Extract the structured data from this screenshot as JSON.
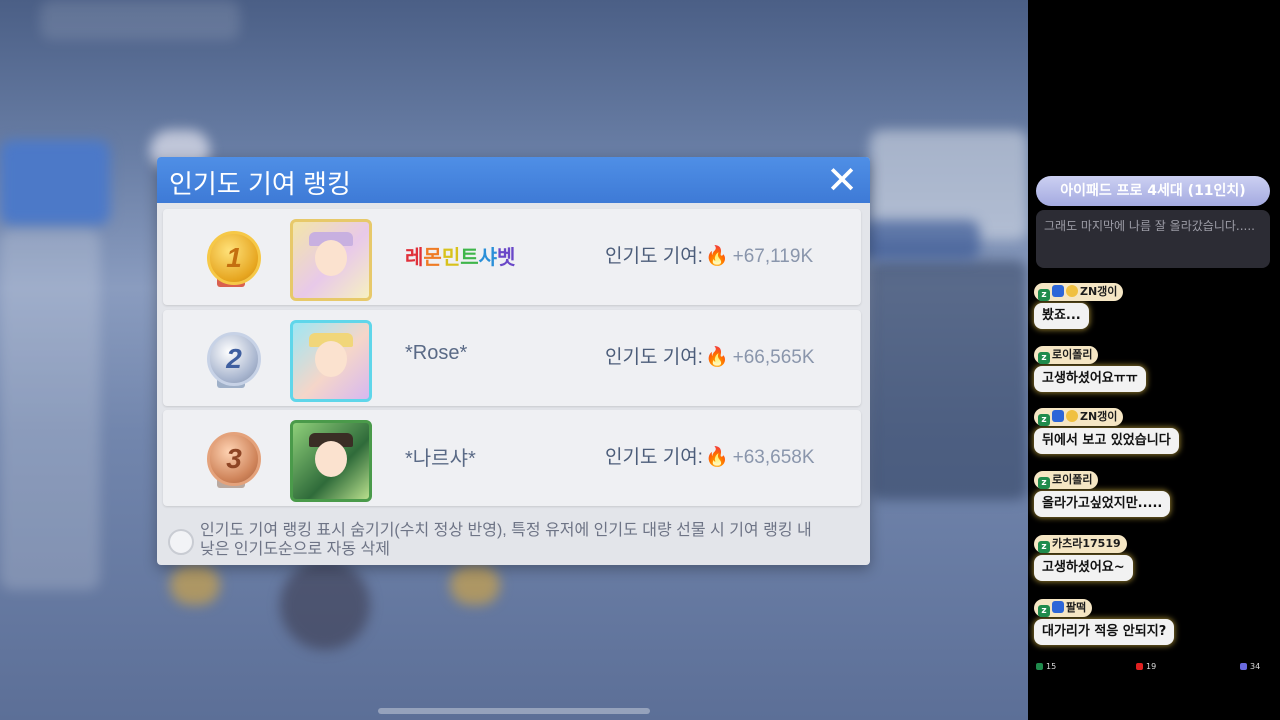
{
  "popup": {
    "title": "인기도 기여 랭킹",
    "close_icon": "✕",
    "contrib_label": "인기도 기여:",
    "entries": [
      {
        "rank": "1",
        "name_parts": [
          "레",
          "몬",
          "민",
          "트",
          "샤",
          "벳"
        ],
        "value": "+67,119K"
      },
      {
        "rank": "2",
        "name": "*Rose*",
        "value": "+66,565K"
      },
      {
        "rank": "3",
        "name": "*나르샤*",
        "value": "+63,658K"
      }
    ],
    "notice": "인기도 기여 랭킹 표시 숨기기(수치 정상 반영), 특정 유저에 인기도 대량 선물 시 기여 랭킹 내 낮은 인기도순으로 자동 삭제"
  },
  "chat": {
    "title": "아이패드 프로 4세대 (11인치)",
    "pinned": "그래도 마지막에 나름 잘 올라갔습니다.....",
    "messages": [
      {
        "user": "ZN갱이",
        "text": "봤죠..."
      },
      {
        "user": "로이폴리",
        "text": "고생하셨어요ㅠㅠ"
      },
      {
        "user": "ZN갱이",
        "text": "뒤에서 보고 있었습니다"
      },
      {
        "user": "로이폴리",
        "text": "올라가고싶었지만....."
      },
      {
        "user": "카츠라17519",
        "text": "고생하셨어요~"
      },
      {
        "user": "팔떡",
        "text": "대가리가 적응 안되지?"
      }
    ],
    "stats": {
      "viewers": "15",
      "youtube": "19",
      "other": "34"
    }
  },
  "colors": {
    "header_blue": "#4a88e2",
    "accent_orange": "#f07824"
  }
}
